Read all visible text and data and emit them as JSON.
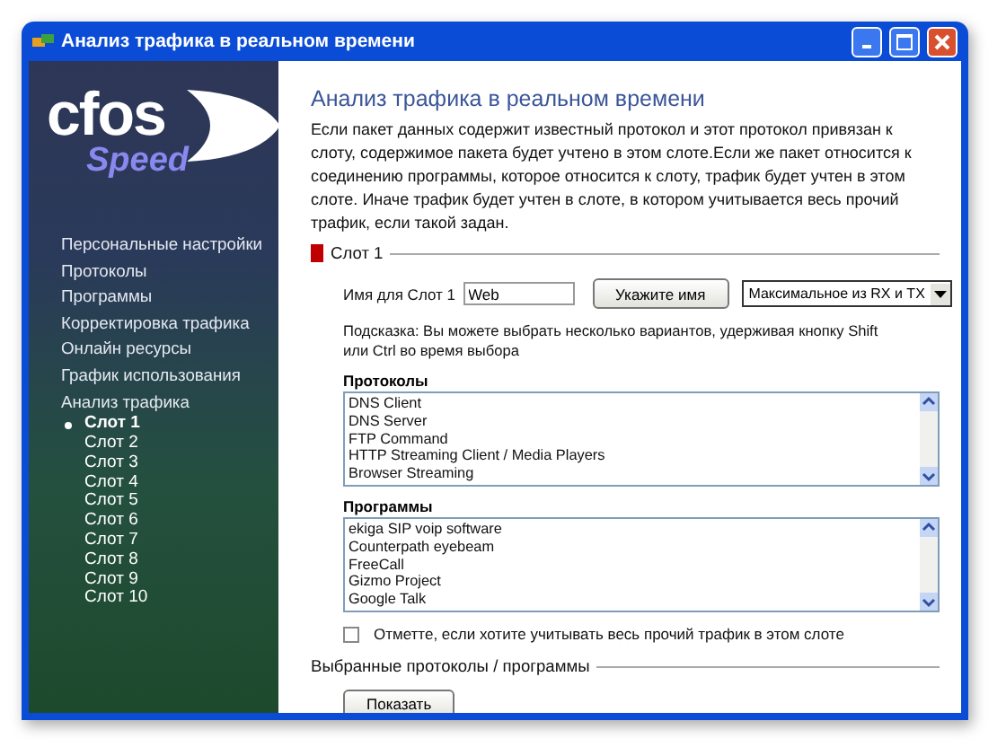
{
  "window": {
    "title": "Анализ трафика в реальном времени"
  },
  "logo": {
    "word": "cfos",
    "subword": "Speed"
  },
  "sidebar": {
    "items": [
      {
        "label": "Персональные настройки",
        "selected": false
      },
      {
        "label": "Протоколы",
        "selected": false
      },
      {
        "label": "Программы",
        "selected": false
      },
      {
        "label": "Корректировка трафика",
        "selected": false
      },
      {
        "label": "Онлайн ресурсы",
        "selected": false
      },
      {
        "label": "График использования",
        "selected": false
      },
      {
        "label": "Анализ трафика",
        "selected": false,
        "children": [
          {
            "label": "Слот 1",
            "selected": true
          },
          {
            "label": "Слот 2",
            "selected": false
          },
          {
            "label": "Слот 3",
            "selected": false
          },
          {
            "label": "Слот 4",
            "selected": false
          },
          {
            "label": "Слот 5",
            "selected": false
          },
          {
            "label": "Слот 6",
            "selected": false
          },
          {
            "label": "Слот 7",
            "selected": false
          },
          {
            "label": "Слот 8",
            "selected": false
          },
          {
            "label": "Слот 9",
            "selected": false
          },
          {
            "label": "Слот 10",
            "selected": false
          }
        ]
      }
    ]
  },
  "content": {
    "title": "Анализ трафика в реальном времени",
    "description": "Если пакет данных содержит известный протокол и этот протокол привязан к слоту, содержимое пакета будет учтено в этом слоте.Если же пакет относится к соединению программы, которое относится к слоту, трафик будет учтен в этом слоте. Иначе трафик будет учтен в слоте, в котором учитывается весь прочий трафик, если такой задан.",
    "slot_section": {
      "title": "Слот 1",
      "color": "#c00000"
    },
    "name_label": "Имя для Слот 1",
    "name_value": "Web",
    "name_button": "Укажите имя",
    "mode_select": "Максимальное из RX и TX",
    "hint": "Подсказка: Вы можете выбрать несколько вариантов, удерживая кнопку Shift или Ctrl во время выбора",
    "protocols": {
      "label": "Протоколы",
      "items": [
        {
          "label": "DNS Client",
          "selected": false
        },
        {
          "label": "DNS Server",
          "selected": false
        },
        {
          "label": "FTP Command",
          "selected": false
        },
        {
          "label": "HTTP Streaming Client / Media Players",
          "selected": false
        },
        {
          "label": "Browser Streaming",
          "selected": false
        }
      ]
    },
    "programs": {
      "label": "Программы",
      "items": [
        {
          "label": "ekiga SIP voip software",
          "selected": false
        },
        {
          "label": "Counterpath eyebeam",
          "selected": false
        },
        {
          "label": "FreeCall",
          "selected": false
        },
        {
          "label": "Gizmo Project",
          "selected": false
        },
        {
          "label": "Google Talk",
          "selected": false
        }
      ]
    },
    "other_traffic": {
      "label": "Отметте, если хотите учитывать весь прочий трафик в этом слоте",
      "checked": false
    },
    "selected_section": {
      "title": "Выбранные протоколы / программы"
    },
    "show_button": "Показать"
  }
}
